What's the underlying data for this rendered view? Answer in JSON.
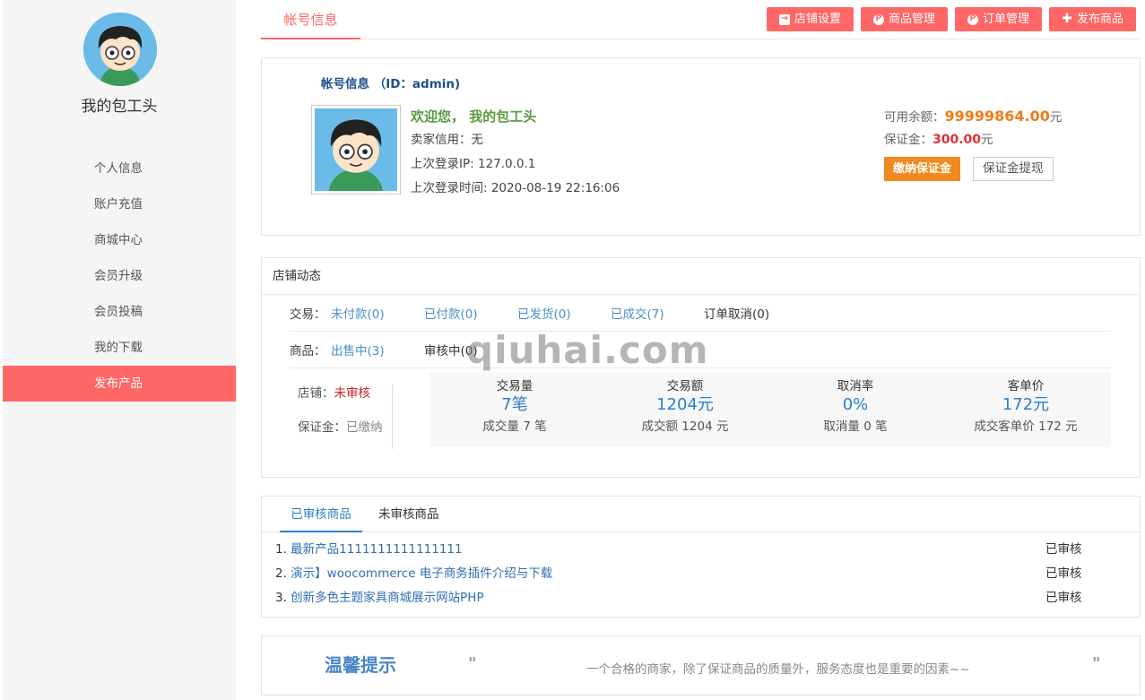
{
  "sidebar": {
    "username": "我的包工头",
    "items": [
      {
        "label": "个人信息"
      },
      {
        "label": "账户充值"
      },
      {
        "label": "商城中心"
      },
      {
        "label": "会员升级"
      },
      {
        "label": "会员投稿"
      },
      {
        "label": "我的下载"
      },
      {
        "label": "发布产品",
        "active": true
      }
    ]
  },
  "header": {
    "tab": "帐号信息",
    "buttons": [
      {
        "label": "店铺设置",
        "icon": "exit-icon"
      },
      {
        "label": "商品管理",
        "icon": "p-circle-icon"
      },
      {
        "label": "订单管理",
        "icon": "p-circle-icon"
      },
      {
        "label": "发布商品",
        "icon": "plus-icon"
      }
    ]
  },
  "account": {
    "title": "帐号信息 （ID：admin)",
    "welcome": "欢迎您， 我的包工头",
    "credit_label": "卖家信用：",
    "credit_value": "无",
    "ip_label": "上次登录IP: ",
    "ip_value": "127.0.0.1",
    "time_label": "上次登录时间: ",
    "time_value": "2020-08-19 22:16:06",
    "balance_label": "可用余额：",
    "balance_value": "99999864.00",
    "balance_unit": "元",
    "deposit_label": "保证金：",
    "deposit_value": "300.00",
    "deposit_unit": "元",
    "pay_deposit_btn": "缴纳保证金",
    "withdraw_btn": "保证金提现"
  },
  "store": {
    "title": "店铺动态",
    "trade_label": "交易：",
    "trade_links": [
      "未付款(0)",
      "已付款(0)",
      "已发货(0)",
      "已成交(7)"
    ],
    "trade_cancel": "订单取消(0)",
    "goods_label": "商品：",
    "goods_link": "出售中(3)",
    "goods_review": "审核中(0)",
    "shop_label": "店铺：",
    "shop_value": "未审核",
    "deposit_label": "保证金：",
    "deposit_value": "已缴纳",
    "stats": [
      {
        "title": "交易量",
        "value": "7笔",
        "sub": "成交量 7 笔"
      },
      {
        "title": "交易额",
        "value": "1204元",
        "sub": "成交额 1204 元"
      },
      {
        "title": "取消率",
        "value": "0%",
        "sub": "取消量 0 笔"
      },
      {
        "title": "客单价",
        "value": "172元",
        "sub": "成交客单价 172 元"
      }
    ]
  },
  "products": {
    "tabs": [
      "已审核商品",
      "未审核商品"
    ],
    "items": [
      {
        "num": "1. ",
        "name": "最新产品1111111111111111",
        "status": "已审核"
      },
      {
        "num": "2. ",
        "name": "演示】woocommerce 电子商务插件介绍与下载",
        "status": "已审核"
      },
      {
        "num": "3. ",
        "name": "创新多色主题家具商城展示网站PHP",
        "status": "已审核"
      }
    ]
  },
  "tip": {
    "title": "温馨提示",
    "quote_open": "\"",
    "quote_close": "\"",
    "text": "一个合格的商家，除了保证商品的质量外，服务态度也是重要的因素~~"
  },
  "watermark": "qiuhai.com",
  "colors": {
    "accent": "#ff6666",
    "link": "#4a90cf",
    "balance": "#f07c1a",
    "deposit": "#e03030"
  }
}
